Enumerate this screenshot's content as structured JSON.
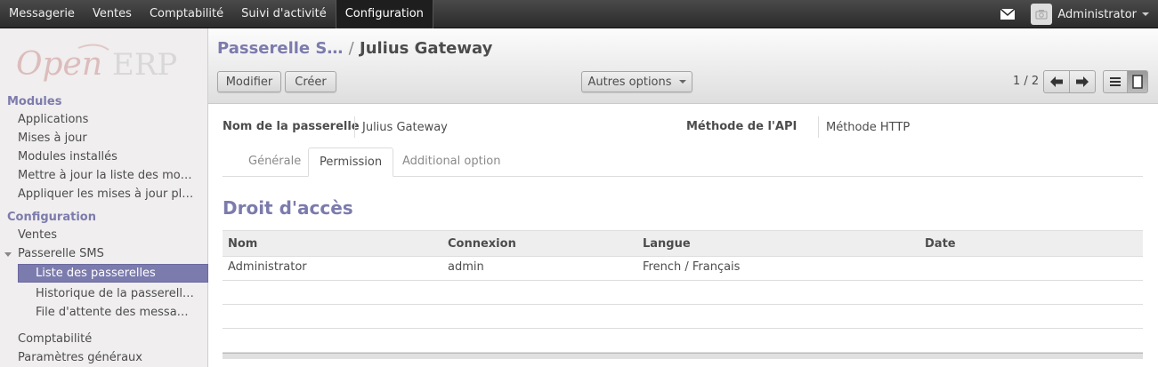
{
  "topbar": {
    "menu": [
      "Messagerie",
      "Ventes",
      "Comptabilité",
      "Suivi d'activité",
      "Configuration"
    ],
    "active_index": 4,
    "user": "Administrator"
  },
  "sidebar": {
    "logo": "OpenERP",
    "sections": [
      {
        "title": "Modules",
        "items": [
          "Applications",
          "Mises à jour",
          "Modules installés",
          "Mettre à jour la liste des mo…",
          "Appliquer les mises à jour pl…"
        ]
      },
      {
        "title": "Configuration",
        "items": [
          "Ventes",
          "Passerelle SMS"
        ],
        "subitems": [
          "Liste des passerelles",
          "Historique de la passerell…",
          "File d'attente des messa…"
        ],
        "after": [
          "Comptabilité",
          "Paramètres généraux"
        ]
      }
    ]
  },
  "header": {
    "breadcrumb_parent": "Passerelle S…",
    "breadcrumb_sep": "/",
    "breadcrumb_current": "Julius Gateway",
    "edit_label": "Modifier",
    "create_label": "Créer",
    "more_label": "Autres options",
    "pager": "1 / 2"
  },
  "form": {
    "name_label": "Nom de la passerelle",
    "name_value": "Julius Gateway",
    "method_label": "Méthode de l'API",
    "method_value": "Méthode HTTP",
    "tabs": [
      "Générale",
      "Permission",
      "Additional option"
    ],
    "active_tab": 1,
    "section_title": "Droit d'accès",
    "columns": [
      "Nom",
      "Connexion",
      "Langue",
      "Date"
    ],
    "rows": [
      [
        "Administrator",
        "admin",
        "French / Français",
        ""
      ]
    ]
  },
  "colors": {
    "accent": "#7c7bad",
    "topbar": "#2b2b2b"
  }
}
